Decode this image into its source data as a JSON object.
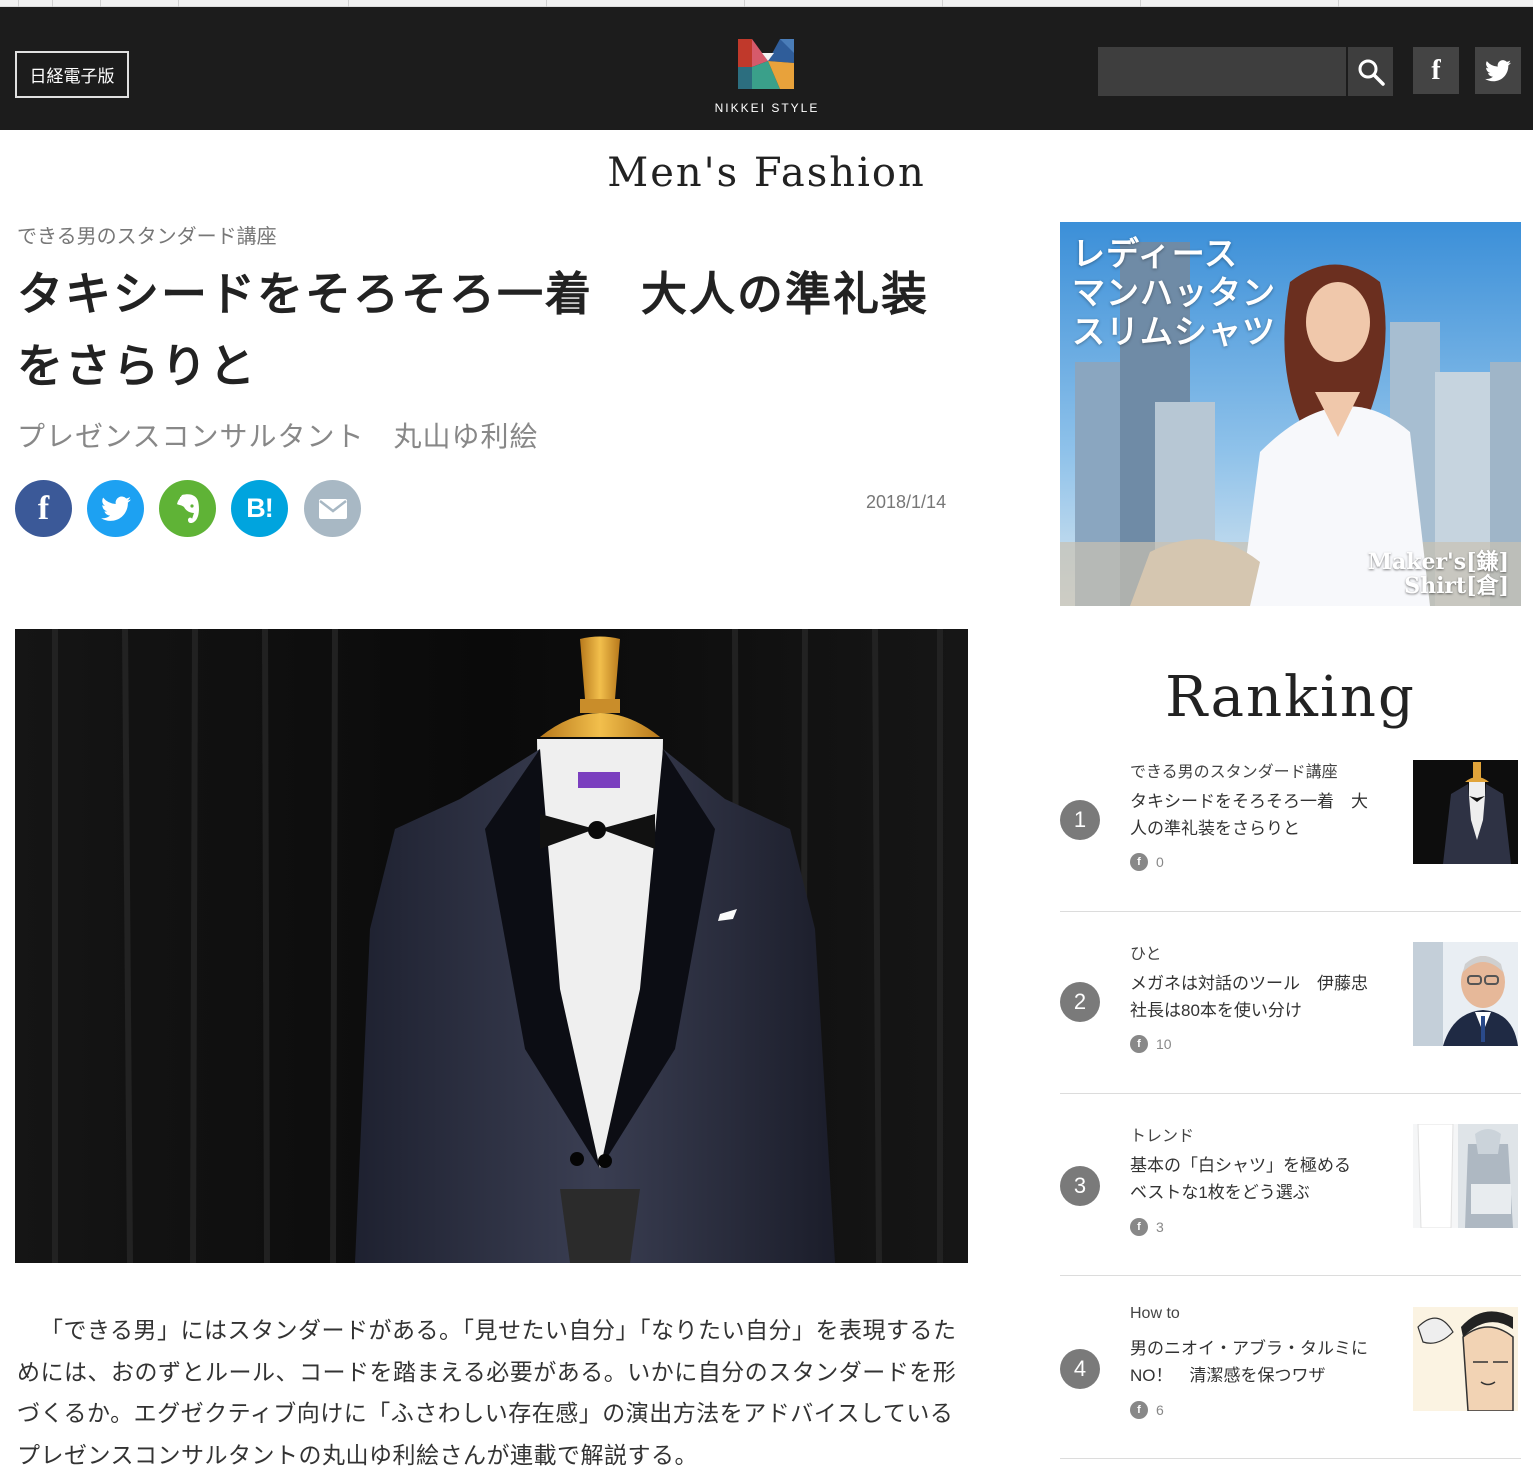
{
  "header": {
    "nikkei_button": "日経電子版",
    "logo_text": "NIKKEI STYLE",
    "search_placeholder": "",
    "facebook_label": "f"
  },
  "section_title": "Men's Fashion",
  "article": {
    "series": "できる男のスタンダード講座",
    "title": "タキシードをそろそろ一着　大人の準礼装をさらりと",
    "author": "プレゼンスコンサルタント　丸山ゆ利絵",
    "date": "2018/1/14",
    "share_buttons": [
      "facebook-icon",
      "twitter-icon",
      "evernote-icon",
      "hatena-bookmark-icon",
      "mail-icon"
    ],
    "hatena_label": "B!",
    "lead": "「できる男」にはスタンダードがある。「見せたい自分」「なりたい自分」を表現するためには、おのずとルール、コードを踏まえる必要がある。いかに自分のスタンダードを形づくるか。エグゼクティブ向けに「ふさわしい存在感」の演出方法をアドバイスしているプレゼンスコンサルタントの丸山ゆ利絵さんが連載で解説する。"
  },
  "ad": {
    "headline": "レディース\nマンハッタン\nスリムシャツ",
    "brand": "Maker's[鎌]\nShirt[倉]"
  },
  "ranking": {
    "title": "Ranking",
    "items": [
      {
        "rank": "1",
        "category": "できる男のスタンダード講座",
        "title": "タキシードをそろそろ一着　大人の準礼装をさらりと",
        "fb_count": "0"
      },
      {
        "rank": "2",
        "category": "ひと",
        "title": "メガネは対話のツール　伊藤忠社長は80本を使い分け",
        "fb_count": "10"
      },
      {
        "rank": "3",
        "category": "トレンド",
        "title": "基本の「白シャツ」を極める　ベストな1枚をどう選ぶ",
        "fb_count": "3"
      },
      {
        "rank": "4",
        "category": "How to",
        "title": "男のニオイ・アブラ・タルミにNO！　清潔感を保つワザ",
        "fb_count": "6"
      }
    ],
    "fb_icon_label": "f"
  },
  "colors": {
    "header_bg": "#1c1c1c",
    "facebook": "#3b5998",
    "twitter": "#1da1f2",
    "evernote": "#5fb336",
    "hatena": "#00a4de",
    "mail": "#a8b8c4",
    "rank_badge": "#7a7a7a"
  }
}
